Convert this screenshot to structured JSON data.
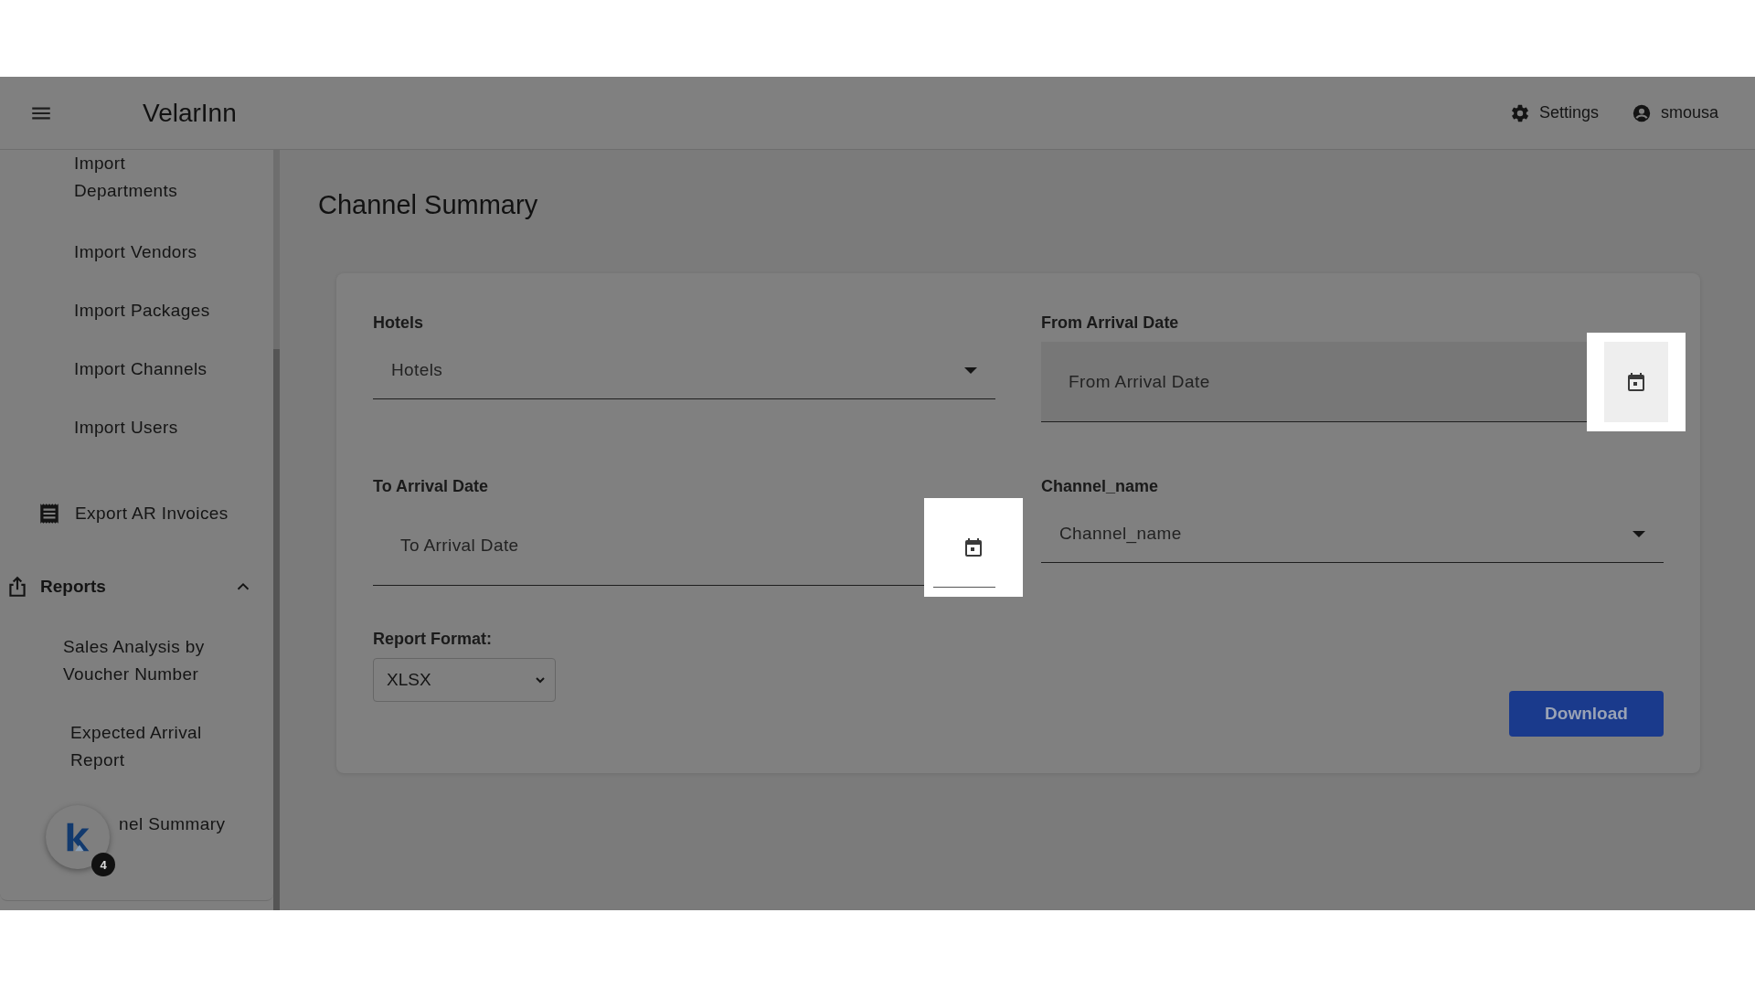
{
  "header": {
    "app_title": "VelarInn",
    "settings": "Settings",
    "user": "smousa"
  },
  "sidebar": {
    "items": [
      {
        "kind": "sub",
        "label": "Import Departments"
      },
      {
        "kind": "sub",
        "label": "Import Vendors"
      },
      {
        "kind": "sub",
        "label": "Import Packages"
      },
      {
        "kind": "sub",
        "label": "Import Channels"
      },
      {
        "kind": "sub",
        "label": "Import Users"
      },
      {
        "kind": "item",
        "label": "Export AR Invoices"
      },
      {
        "kind": "section",
        "label": "Reports",
        "expanded": true,
        "children": [
          {
            "label": "Sales Analysis by Voucher Number"
          },
          {
            "label": "Expected Arrival Report"
          },
          {
            "label": "nel Summary"
          }
        ]
      }
    ]
  },
  "chat_widget": {
    "badge": "4"
  },
  "page": {
    "title": "Channel Summary",
    "fields": [
      {
        "kind": "select",
        "label": "Hotels",
        "placeholder": "Hotels"
      },
      {
        "kind": "date",
        "label": "From Arrival Date",
        "placeholder": "From Arrival Date",
        "filled": true
      },
      {
        "kind": "date",
        "label": "To Arrival Date",
        "placeholder": "To Arrival Date",
        "filled": false
      },
      {
        "kind": "select",
        "label": "Channel_name",
        "placeholder": "Channel_name"
      }
    ],
    "report_format": {
      "label": "Report Format:",
      "value": "XLSX"
    },
    "download": "Download"
  }
}
